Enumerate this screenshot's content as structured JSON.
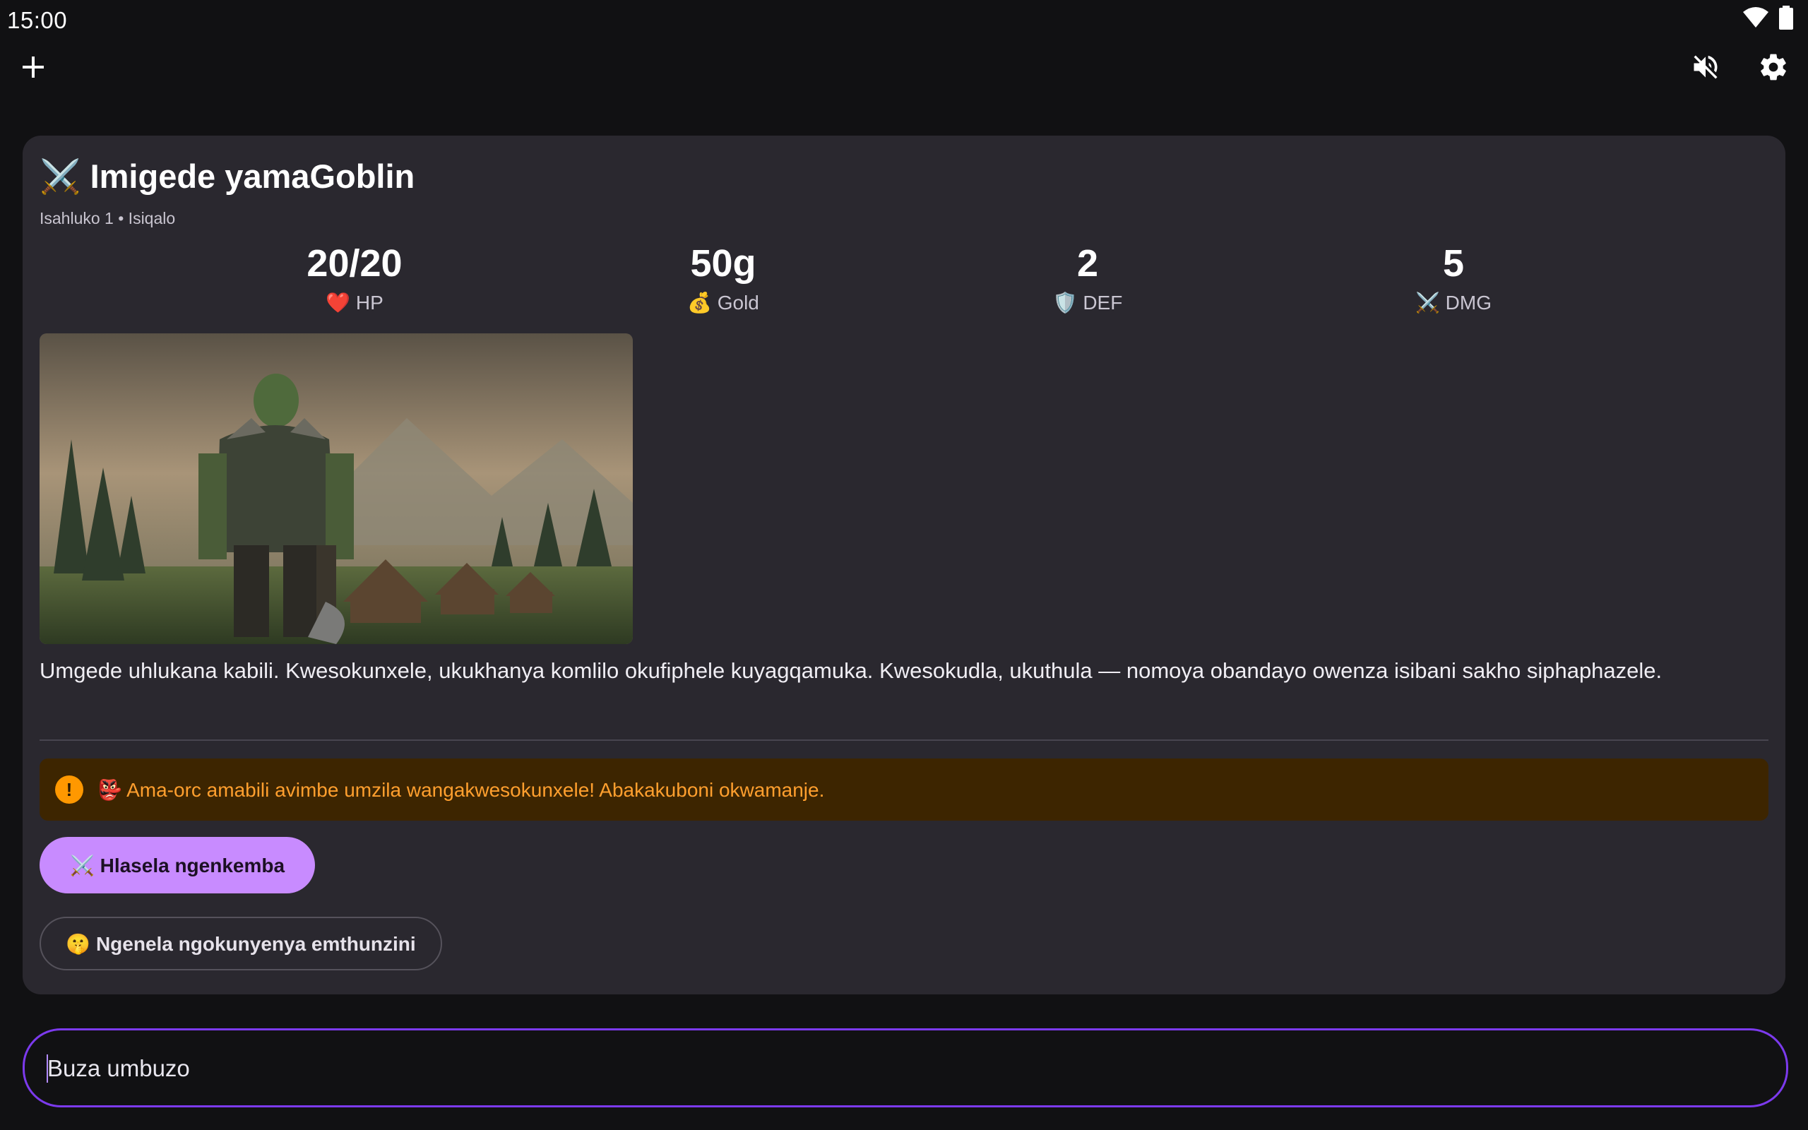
{
  "status_bar": {
    "time": "15:00"
  },
  "app_bar": {
    "add_icon": "plus-icon",
    "mute_icon": "volume-off-icon",
    "settings_icon": "gear-icon"
  },
  "game": {
    "title": "⚔️ Imigede yamaGoblin",
    "subtitle": "Isahluko 1 • Isiqalo",
    "stats": [
      {
        "value": "20/20",
        "label": "❤️ HP"
      },
      {
        "value": "50g",
        "label": "💰 Gold"
      },
      {
        "value": "2",
        "label": "🛡️ DEF"
      },
      {
        "value": "5",
        "label": "⚔️ DMG"
      }
    ],
    "narrative": "Umgede uhlukana kabili. Kwesokunxele, ukukhanya komlilo okufiphele kuyagqamuka. Kwesokudla, ukuthula — nomoya obandayo owenza isibani sakho siphaphazele.",
    "alert": {
      "icon": "!",
      "text": "👺 Ama-orc amabili avimbe umzila wangakwesokunxele! Abakakuboni okwamanje."
    },
    "actions": {
      "attack": "⚔️ Hlasela ngenkemba",
      "sneak": "🤫 Ngenela ngokunyenya emthunzini"
    }
  },
  "input": {
    "placeholder": "Buza umbuzo"
  },
  "colors": {
    "accent": "#c88bff",
    "input_border": "#7c3aed",
    "alert_bg": "#3d2500",
    "alert_text": "#ff9f2e",
    "card_bg": "#2a282f"
  }
}
